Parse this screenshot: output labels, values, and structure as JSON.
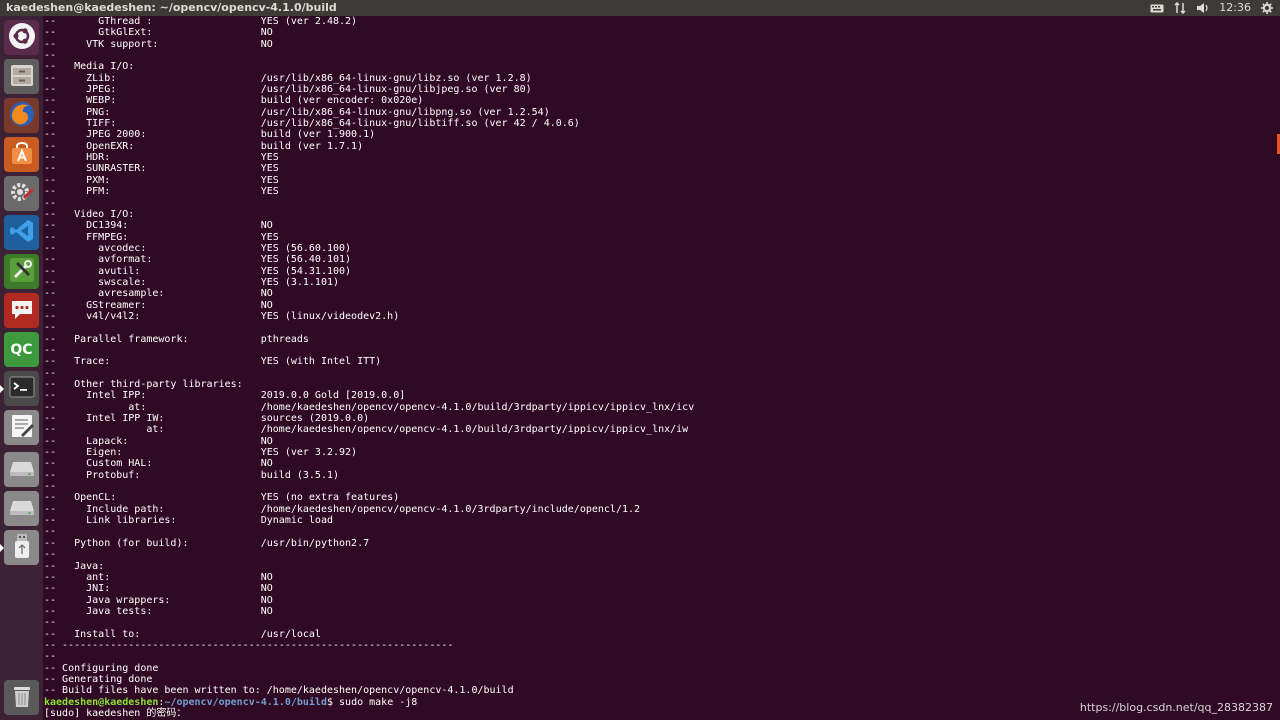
{
  "window": {
    "title": "kaedeshen@kaedeshen: ~/opencv/opencv-4.1.0/build"
  },
  "tray": {
    "keyboard_icon": "keyboard-icon",
    "network_icon": "network-updown-icon",
    "volume_icon": "volume-icon",
    "clock": "12:36",
    "settings_icon": "gear-icon"
  },
  "launcher": {
    "items": [
      {
        "name": "ubuntu-dash",
        "icon": "ubuntu-logo-icon"
      },
      {
        "name": "files",
        "icon": "file-cabinet-icon"
      },
      {
        "name": "firefox",
        "icon": "firefox-icon"
      },
      {
        "name": "software-center",
        "icon": "shopping-bag-icon"
      },
      {
        "name": "system-settings",
        "icon": "gear-wrench-icon"
      },
      {
        "name": "vscode",
        "icon": "vscode-icon"
      },
      {
        "name": "tools",
        "icon": "wrench-screwdriver-icon"
      },
      {
        "name": "messaging",
        "icon": "chat-bubble-icon"
      },
      {
        "name": "qt-creator",
        "icon": "qc-icon",
        "label": "QC"
      },
      {
        "name": "terminal",
        "icon": "terminal-icon"
      },
      {
        "name": "text-editor",
        "icon": "text-editor-icon"
      },
      {
        "name": "drive-1",
        "icon": "hard-drive-icon"
      },
      {
        "name": "drive-2",
        "icon": "hard-drive-icon"
      },
      {
        "name": "usb",
        "icon": "usb-drive-icon"
      },
      {
        "name": "trash",
        "icon": "trash-icon"
      }
    ]
  },
  "terminal": {
    "lines": [
      "--       GThread :                  YES (ver 2.48.2)",
      "--       GtkGlExt:                  NO",
      "--     VTK support:                 NO",
      "--",
      "--   Media I/O:",
      "--     ZLib:                        /usr/lib/x86_64-linux-gnu/libz.so (ver 1.2.8)",
      "--     JPEG:                        /usr/lib/x86_64-linux-gnu/libjpeg.so (ver 80)",
      "--     WEBP:                        build (ver encoder: 0x020e)",
      "--     PNG:                         /usr/lib/x86_64-linux-gnu/libpng.so (ver 1.2.54)",
      "--     TIFF:                        /usr/lib/x86_64-linux-gnu/libtiff.so (ver 42 / 4.0.6)",
      "--     JPEG 2000:                   build (ver 1.900.1)",
      "--     OpenEXR:                     build (ver 1.7.1)",
      "--     HDR:                         YES",
      "--     SUNRASTER:                   YES",
      "--     PXM:                         YES",
      "--     PFM:                         YES",
      "--",
      "--   Video I/O:",
      "--     DC1394:                      NO",
      "--     FFMPEG:                      YES",
      "--       avcodec:                   YES (56.60.100)",
      "--       avformat:                  YES (56.40.101)",
      "--       avutil:                    YES (54.31.100)",
      "--       swscale:                   YES (3.1.101)",
      "--       avresample:                NO",
      "--     GStreamer:                   NO",
      "--     v4l/v4l2:                    YES (linux/videodev2.h)",
      "--",
      "--   Parallel framework:            pthreads",
      "--",
      "--   Trace:                         YES (with Intel ITT)",
      "--",
      "--   Other third-party libraries:",
      "--     Intel IPP:                   2019.0.0 Gold [2019.0.0]",
      "--            at:                   /home/kaedeshen/opencv/opencv-4.1.0/build/3rdparty/ippicv/ippicv_lnx/icv",
      "--     Intel IPP IW:                sources (2019.0.0)",
      "--               at:                /home/kaedeshen/opencv/opencv-4.1.0/build/3rdparty/ippicv/ippicv_lnx/iw",
      "--     Lapack:                      NO",
      "--     Eigen:                       YES (ver 3.2.92)",
      "--     Custom HAL:                  NO",
      "--     Protobuf:                    build (3.5.1)",
      "--",
      "--   OpenCL:                        YES (no extra features)",
      "--     Include path:                /home/kaedeshen/opencv/opencv-4.1.0/3rdparty/include/opencl/1.2",
      "--     Link libraries:              Dynamic load",
      "--",
      "--   Python (for build):            /usr/bin/python2.7",
      "--",
      "--   Java:",
      "--     ant:                         NO",
      "--     JNI:                         NO",
      "--     Java wrappers:               NO",
      "--     Java tests:                  NO",
      "--",
      "--   Install to:                    /usr/local",
      "-- -----------------------------------------------------------------",
      "--",
      "-- Configuring done",
      "-- Generating done",
      "-- Build files have been written to: /home/kaedeshen/opencv/opencv-4.1.0/build"
    ],
    "prompt": {
      "user": "kaedeshen@kaedeshen",
      "sep": ":",
      "path": "~/opencv/opencv-4.1.0/build",
      "dollar": "$ ",
      "command": "sudo make -j8"
    },
    "sudo_prompt": "[sudo] kaedeshen 的密码："
  },
  "watermark": "https://blog.csdn.net/qq_28382387"
}
